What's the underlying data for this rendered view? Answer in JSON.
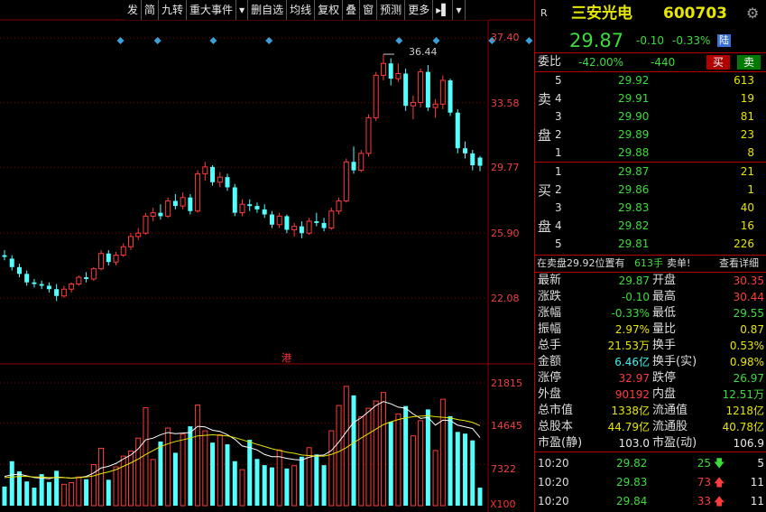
{
  "toolbar": {
    "items": [
      "发",
      "简",
      "九转",
      "重大事件",
      "▾",
      "删自选",
      "均线",
      "复权",
      "叠",
      "窗",
      "预测",
      "更多",
      "▸▌",
      "▾"
    ]
  },
  "price_axis": {
    "labels": [
      "37.40",
      "33.58",
      "29.77",
      "25.90",
      "22.08"
    ],
    "peak_label": "36.44",
    "hk_mark": "港"
  },
  "volume_axis": {
    "labels": [
      "21815",
      "14645",
      "7322"
    ],
    "unit": "X100"
  },
  "header": {
    "market_tag": "R",
    "name": "三安光电",
    "code": "600703",
    "price": "29.87",
    "change": "-0.10",
    "change_pct": "-0.33%",
    "exchange_badge": "陆"
  },
  "weibi": {
    "label": "委比",
    "ratio": "-42.00%",
    "diff": "-440",
    "buy_btn": "买",
    "sell_btn": "卖"
  },
  "sell_side": {
    "label_chars": [
      "卖",
      "盘"
    ],
    "levels": [
      {
        "level": "5",
        "price": "29.92",
        "vol": "613"
      },
      {
        "level": "4",
        "price": "29.91",
        "vol": "19"
      },
      {
        "level": "3",
        "price": "29.90",
        "vol": "81"
      },
      {
        "level": "2",
        "price": "29.89",
        "vol": "23"
      },
      {
        "level": "1",
        "price": "29.88",
        "vol": "8"
      }
    ]
  },
  "buy_side": {
    "label_chars": [
      "买",
      "盘"
    ],
    "levels": [
      {
        "level": "1",
        "price": "29.87",
        "vol": "21"
      },
      {
        "level": "2",
        "price": "29.86",
        "vol": "1"
      },
      {
        "level": "3",
        "price": "29.83",
        "vol": "40"
      },
      {
        "level": "4",
        "price": "29.82",
        "vol": "16"
      },
      {
        "level": "5",
        "price": "29.81",
        "vol": "226"
      }
    ]
  },
  "notice": {
    "text_prefix": "在卖盘29.92位置有",
    "text_qty": "613手",
    "text_suffix": "卖单!",
    "detail_link": "查看详细"
  },
  "stats": [
    {
      "k1": "最新",
      "v1": "29.87",
      "c1": "green",
      "k2": "开盘",
      "v2": "30.35",
      "c2": "red"
    },
    {
      "k1": "涨跌",
      "v1": "-0.10",
      "c1": "green",
      "k2": "最高",
      "v2": "30.44",
      "c2": "red"
    },
    {
      "k1": "涨幅",
      "v1": "-0.33%",
      "c1": "green",
      "k2": "最低",
      "v2": "29.55",
      "c2": "green"
    },
    {
      "k1": "振幅",
      "v1": "2.97%",
      "c1": "yellow",
      "k2": "量比",
      "v2": "0.87",
      "c2": "yellow"
    },
    {
      "k1": "总手",
      "v1": "21.53万",
      "c1": "yellow",
      "k2": "换手",
      "v2": "0.53%",
      "c2": "yellow"
    },
    {
      "k1": "金额",
      "v1": "6.46亿",
      "c1": "cyan",
      "k2": "换手(实)",
      "v2": "0.98%",
      "c2": "yellow"
    },
    {
      "k1": "涨停",
      "v1": "32.97",
      "c1": "red",
      "k2": "跌停",
      "v2": "26.97",
      "c2": "green"
    },
    {
      "k1": "外盘",
      "v1": "90192",
      "c1": "red",
      "k2": "内盘",
      "v2": "12.51万",
      "c2": "green"
    },
    {
      "k1": "总市值",
      "v1": "1338亿",
      "c1": "yellow",
      "k2": "流通值",
      "v2": "1218亿",
      "c2": "yellow"
    },
    {
      "k1": "总股本",
      "v1": "44.79亿",
      "c1": "yellow",
      "k2": "流通股",
      "v2": "40.78亿",
      "c2": "yellow"
    },
    {
      "k1": "市盈(静)",
      "v1": "103.0",
      "c1": "white",
      "k2": "市盈(动)",
      "v2": "106.9",
      "c2": "white"
    }
  ],
  "ticks": [
    {
      "time": "10:20",
      "price": "29.82",
      "vol": "25",
      "dir": "down",
      "count": "5"
    },
    {
      "time": "10:20",
      "price": "29.83",
      "vol": "73",
      "dir": "up",
      "count": "11"
    },
    {
      "time": "10:20",
      "price": "29.84",
      "vol": "33",
      "dir": "up",
      "count": "11"
    }
  ],
  "colors": {
    "up": "#ff3b3b",
    "down": "#54ffff",
    "grid": "#8b0000",
    "ma1": "#ffffff",
    "ma2": "#e6e600",
    "diamond": "#3ca0d8"
  },
  "chart_data": {
    "type": "candlestick",
    "price_axis": [
      22.08,
      25.9,
      29.77,
      33.58,
      37.4
    ],
    "candles": [
      {
        "o": 24.6,
        "h": 24.9,
        "l": 24.3,
        "c": 24.5
      },
      {
        "o": 24.4,
        "h": 24.6,
        "l": 23.7,
        "c": 23.9
      },
      {
        "o": 23.9,
        "h": 24.1,
        "l": 23.3,
        "c": 23.5
      },
      {
        "o": 23.5,
        "h": 23.7,
        "l": 22.8,
        "c": 23.0
      },
      {
        "o": 23.0,
        "h": 23.2,
        "l": 22.7,
        "c": 22.9
      },
      {
        "o": 22.9,
        "h": 23.1,
        "l": 22.6,
        "c": 22.8
      },
      {
        "o": 22.8,
        "h": 23.0,
        "l": 22.4,
        "c": 22.6
      },
      {
        "o": 22.6,
        "h": 22.9,
        "l": 21.9,
        "c": 22.2
      },
      {
        "o": 22.2,
        "h": 22.8,
        "l": 22.1,
        "c": 22.6
      },
      {
        "o": 22.6,
        "h": 23.0,
        "l": 22.4,
        "c": 22.9
      },
      {
        "o": 22.9,
        "h": 23.4,
        "l": 22.8,
        "c": 23.3
      },
      {
        "o": 23.3,
        "h": 23.6,
        "l": 23.0,
        "c": 23.2
      },
      {
        "o": 23.2,
        "h": 23.9,
        "l": 23.1,
        "c": 23.8
      },
      {
        "o": 23.8,
        "h": 24.9,
        "l": 23.7,
        "c": 24.7
      },
      {
        "o": 24.7,
        "h": 24.9,
        "l": 24.0,
        "c": 24.2
      },
      {
        "o": 24.2,
        "h": 24.8,
        "l": 24.0,
        "c": 24.6
      },
      {
        "o": 24.6,
        "h": 25.3,
        "l": 24.5,
        "c": 25.1
      },
      {
        "o": 25.1,
        "h": 25.9,
        "l": 24.9,
        "c": 25.7
      },
      {
        "o": 25.7,
        "h": 26.2,
        "l": 25.5,
        "c": 25.9
      },
      {
        "o": 25.9,
        "h": 27.1,
        "l": 25.8,
        "c": 26.9
      },
      {
        "o": 26.9,
        "h": 27.4,
        "l": 26.6,
        "c": 27.1
      },
      {
        "o": 27.1,
        "h": 27.6,
        "l": 26.7,
        "c": 26.9
      },
      {
        "o": 26.9,
        "h": 28.0,
        "l": 26.8,
        "c": 27.8
      },
      {
        "o": 27.8,
        "h": 28.2,
        "l": 27.3,
        "c": 27.5
      },
      {
        "o": 27.5,
        "h": 28.3,
        "l": 27.3,
        "c": 28.0
      },
      {
        "o": 28.0,
        "h": 28.2,
        "l": 27.0,
        "c": 27.2
      },
      {
        "o": 27.2,
        "h": 29.6,
        "l": 27.1,
        "c": 29.4
      },
      {
        "o": 29.4,
        "h": 30.1,
        "l": 29.0,
        "c": 29.8
      },
      {
        "o": 29.8,
        "h": 29.9,
        "l": 28.7,
        "c": 28.9
      },
      {
        "o": 28.9,
        "h": 29.5,
        "l": 28.6,
        "c": 29.2
      },
      {
        "o": 29.2,
        "h": 29.4,
        "l": 28.4,
        "c": 28.6
      },
      {
        "o": 28.6,
        "h": 28.8,
        "l": 26.9,
        "c": 27.1
      },
      {
        "o": 27.1,
        "h": 27.9,
        "l": 26.9,
        "c": 27.6
      },
      {
        "o": 27.6,
        "h": 27.9,
        "l": 27.2,
        "c": 27.5
      },
      {
        "o": 27.5,
        "h": 27.7,
        "l": 27.1,
        "c": 27.3
      },
      {
        "o": 27.3,
        "h": 27.6,
        "l": 26.8,
        "c": 27.0
      },
      {
        "o": 27.0,
        "h": 27.2,
        "l": 26.2,
        "c": 26.4
      },
      {
        "o": 26.4,
        "h": 27.1,
        "l": 26.2,
        "c": 26.9
      },
      {
        "o": 26.9,
        "h": 27.0,
        "l": 25.9,
        "c": 26.1
      },
      {
        "o": 26.1,
        "h": 26.5,
        "l": 25.7,
        "c": 26.3
      },
      {
        "o": 26.3,
        "h": 26.6,
        "l": 25.6,
        "c": 25.9
      },
      {
        "o": 25.9,
        "h": 26.8,
        "l": 25.8,
        "c": 26.6
      },
      {
        "o": 26.6,
        "h": 27.1,
        "l": 26.3,
        "c": 26.5
      },
      {
        "o": 26.5,
        "h": 26.8,
        "l": 26.0,
        "c": 26.2
      },
      {
        "o": 26.2,
        "h": 27.4,
        "l": 26.1,
        "c": 27.2
      },
      {
        "o": 27.2,
        "h": 28.0,
        "l": 27.0,
        "c": 27.8
      },
      {
        "o": 27.8,
        "h": 30.3,
        "l": 27.7,
        "c": 30.1
      },
      {
        "o": 30.1,
        "h": 31.0,
        "l": 29.4,
        "c": 29.6
      },
      {
        "o": 29.6,
        "h": 30.8,
        "l": 29.5,
        "c": 30.6
      },
      {
        "o": 30.6,
        "h": 32.9,
        "l": 30.4,
        "c": 32.7
      },
      {
        "o": 32.7,
        "h": 35.4,
        "l": 32.5,
        "c": 35.2
      },
      {
        "o": 35.2,
        "h": 36.44,
        "l": 34.9,
        "c": 35.9
      },
      {
        "o": 35.9,
        "h": 36.2,
        "l": 34.6,
        "c": 35.0
      },
      {
        "o": 35.0,
        "h": 35.9,
        "l": 34.8,
        "c": 35.3
      },
      {
        "o": 35.3,
        "h": 35.6,
        "l": 33.1,
        "c": 33.4
      },
      {
        "o": 33.4,
        "h": 34.0,
        "l": 32.6,
        "c": 33.6
      },
      {
        "o": 33.6,
        "h": 35.6,
        "l": 33.3,
        "c": 35.4
      },
      {
        "o": 35.4,
        "h": 35.8,
        "l": 33.1,
        "c": 33.3
      },
      {
        "o": 33.3,
        "h": 33.8,
        "l": 32.7,
        "c": 33.5
      },
      {
        "o": 33.5,
        "h": 35.2,
        "l": 33.2,
        "c": 34.9
      },
      {
        "o": 34.9,
        "h": 35.0,
        "l": 32.8,
        "c": 33.0
      },
      {
        "o": 33.0,
        "h": 33.2,
        "l": 30.6,
        "c": 30.9
      },
      {
        "o": 30.9,
        "h": 31.3,
        "l": 30.3,
        "c": 30.6
      },
      {
        "o": 30.6,
        "h": 30.8,
        "l": 29.6,
        "c": 29.9
      },
      {
        "o": 30.35,
        "h": 30.44,
        "l": 29.55,
        "c": 29.87
      }
    ],
    "volume_axis": [
      7322,
      14645,
      21815
    ],
    "volumes": [
      3400,
      7900,
      6100,
      4300,
      3200,
      5600,
      4200,
      6200,
      3800,
      4100,
      5100,
      4700,
      7300,
      10200,
      4600,
      6900,
      8800,
      9700,
      12000,
      17400,
      8200,
      11400,
      13800,
      9400,
      12700,
      14100,
      17900,
      13300,
      11200,
      12600,
      10900,
      7900,
      6400,
      11700,
      8300,
      7200,
      6800,
      9900,
      6600,
      7100,
      8700,
      10300,
      9100,
      7200,
      13300,
      17800,
      21200,
      19600,
      15800,
      17300,
      18600,
      20100,
      14900,
      16300,
      17700,
      12400,
      15100,
      17100,
      9800,
      18900,
      15900,
      13100,
      12800,
      11600,
      3200
    ],
    "ma_volume_1": [
      5200,
      5500,
      5600,
      5300,
      5000,
      4900,
      4800,
      5100,
      5000,
      4900,
      5000,
      5200,
      5800,
      6700,
      7000,
      7500,
      8300,
      9000,
      10100,
      11700,
      12000,
      12600,
      13000,
      12800,
      12900,
      13000,
      14100,
      14000,
      13400,
      13200,
      12600,
      11800,
      10600,
      10300,
      9900,
      9100,
      8700,
      8700,
      8400,
      8200,
      8100,
      8600,
      8900,
      9000,
      9800,
      11300,
      13100,
      14800,
      15600,
      16700,
      17800,
      18500,
      18100,
      17500,
      17300,
      16300,
      15500,
      15700,
      14300,
      15200,
      15100,
      14300,
      14000,
      13700,
      12100
    ],
    "ma_volume_2": [
      5000,
      5100,
      5200,
      5200,
      5100,
      5100,
      5000,
      5000,
      5000,
      4900,
      5000,
      5100,
      5300,
      5700,
      6000,
      6400,
      7000,
      7600,
      8300,
      9100,
      9800,
      10500,
      11000,
      11400,
      11700,
      12000,
      12400,
      12500,
      12600,
      12500,
      12400,
      12100,
      11700,
      11300,
      10900,
      10500,
      10100,
      9800,
      9500,
      9300,
      9000,
      8900,
      8800,
      8800,
      9100,
      9600,
      10300,
      11200,
      12000,
      12800,
      13600,
      14400,
      14900,
      15300,
      15600,
      15800,
      15900,
      16000,
      15800,
      15700,
      15600,
      15300,
      15100,
      14800,
      14200
    ],
    "event_markers": [
      6,
      8,
      11,
      14,
      21,
      23,
      26,
      28
    ]
  }
}
